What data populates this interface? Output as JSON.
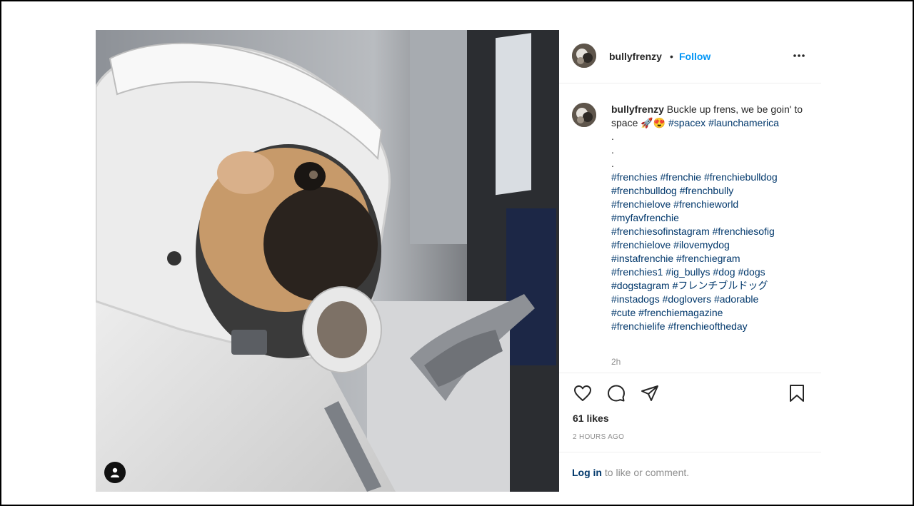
{
  "post": {
    "username": "bullyfrenzy",
    "follow_label": "Follow",
    "separator": "•",
    "caption_text": "Buckle up frens, we be goin' to space 🚀😍",
    "caption_tags_1": "#spacex",
    "caption_tags_2": "#launchamerica",
    "dots": [
      ".",
      ".",
      "."
    ],
    "hashtag_lines": [
      "#frenchies #frenchie #frenchiebulldog",
      "#frenchbulldog #frenchbully",
      "#frenchielove #frenchieworld",
      "#myfavfrenchie",
      "#frenchiesofinstagram #frenchiesofig",
      "#frenchielove #ilovemydog",
      "#instafrenchie #frenchiegram",
      "#frenchies1 #ig_bullys #dog #dogs",
      "#dogstagram #フレンチブルドッグ",
      "#instadogs #doglovers #adorable",
      "#cute #frenchiemagazine",
      "#frenchielife #frenchieoftheday"
    ],
    "comment_time": "2h",
    "likes": "61 likes",
    "time_ago": "2 HOURS AGO",
    "login_link": "Log in",
    "login_suffix": " to like or comment."
  },
  "icons": {
    "more": "more-options-icon",
    "like": "heart-icon",
    "comment": "comment-icon",
    "share": "share-icon",
    "save": "bookmark-icon",
    "tagged": "user-tag-icon"
  },
  "colors": {
    "link": "#00376b",
    "follow": "#0095f6",
    "muted": "#8e8e8e",
    "text": "#262626"
  }
}
